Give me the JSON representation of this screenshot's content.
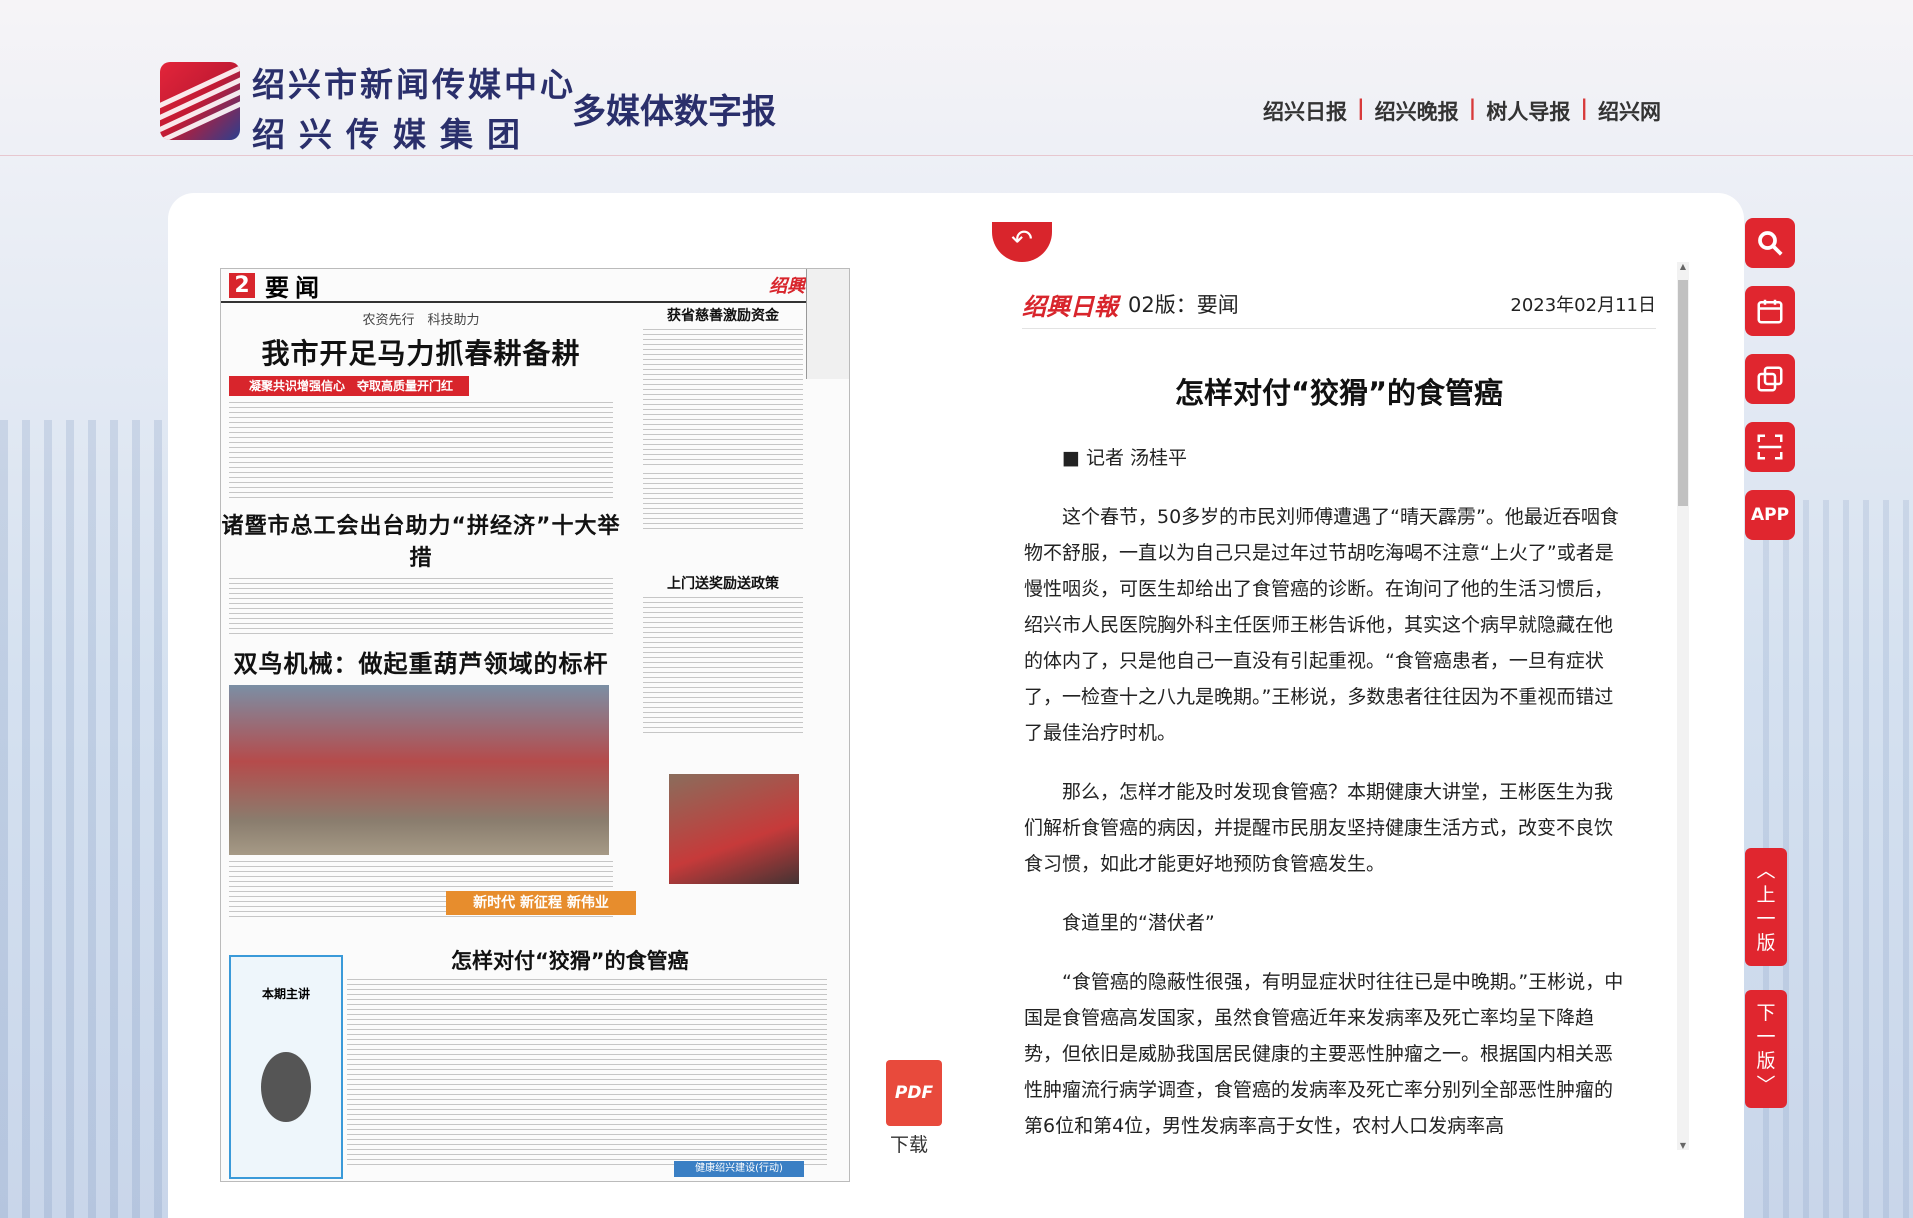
{
  "header": {
    "org_line1": "绍兴市新闻传媒中心",
    "org_line2": "绍兴传媒集团",
    "site_title": "多媒体数字报",
    "nav": [
      "绍兴日报",
      "绍兴晚报",
      "树人导报",
      "绍兴网"
    ]
  },
  "newspaper": {
    "page_num": "2",
    "section": "要闻",
    "logo": "绍興日報",
    "kicker": "农资先行　科技助力",
    "headline1": "我市开足马力抓春耕备耕",
    "redbar": "凝聚共识增强信心　夺取高质量开门红",
    "headline2": "诸暨市总工会出台助力“拼经济”十大举措",
    "headline3": "双鸟机械：做起重葫芦领域的标杆",
    "side_head1": "获省慈善激励资金",
    "side_head2": "上门送奖励送政策",
    "promo": "新时代 新征程 新伟业",
    "headline4": "怎样对付“狡猾”的食管癌",
    "health_label": "本期主讲",
    "blue_tag": "健康绍兴建设(行动)"
  },
  "pdf": {
    "icon_text": "PDF",
    "label": "下载"
  },
  "article": {
    "brand": "绍興日報",
    "page": "02版：要闻",
    "date": "2023年02月11日",
    "title": "怎样对付“狡猾”的食管癌",
    "author": "■ 记者 汤桂平",
    "paragraphs": [
      "这个春节，50多岁的市民刘师傅遭遇了“晴天霹雳”。他最近吞咽食物不舒服，一直以为自己只是过年过节胡吃海喝不注意“上火了”或者是慢性咽炎，可医生却给出了食管癌的诊断。在询问了他的生活习惯后，绍兴市人民医院胸外科主任医师王彬告诉他，其实这个病早就隐藏在他的体内了，只是他自己一直没有引起重视。“食管癌患者，一旦有症状了，一检查十之八九是晚期。”王彬说，多数患者往往因为不重视而错过了最佳治疗时机。",
      "那么，怎样才能及时发现食管癌？本期健康大讲堂，王彬医生为我们解析食管癌的病因，并提醒市民朋友坚持健康生活方式，改变不良饮食习惯，如此才能更好地预防食管癌发生。",
      "食道里的“潜伏者”",
      "“食管癌的隐蔽性很强，有明显症状时往往已是中晚期。”王彬说，中国是食管癌高发国家，虽然食管癌近年来发病率及死亡率均呈下降趋势，但依旧是威胁我国居民健康的主要恶性肿瘤之一。根据国内相关恶性肿瘤流行病学调查，食管癌的发病率及死亡率分别列全部恶性肿瘤的第6位和第4位，男性发病率高于女性，农村人口发病率高"
    ]
  },
  "tools": {
    "search": "search-icon",
    "calendar": "calendar-icon",
    "copy": "copy-icon",
    "scan": "scan-icon",
    "app": "APP"
  },
  "pager": {
    "prev": [
      "上",
      "一",
      "版"
    ],
    "next": [
      "下",
      "一",
      "版"
    ]
  }
}
